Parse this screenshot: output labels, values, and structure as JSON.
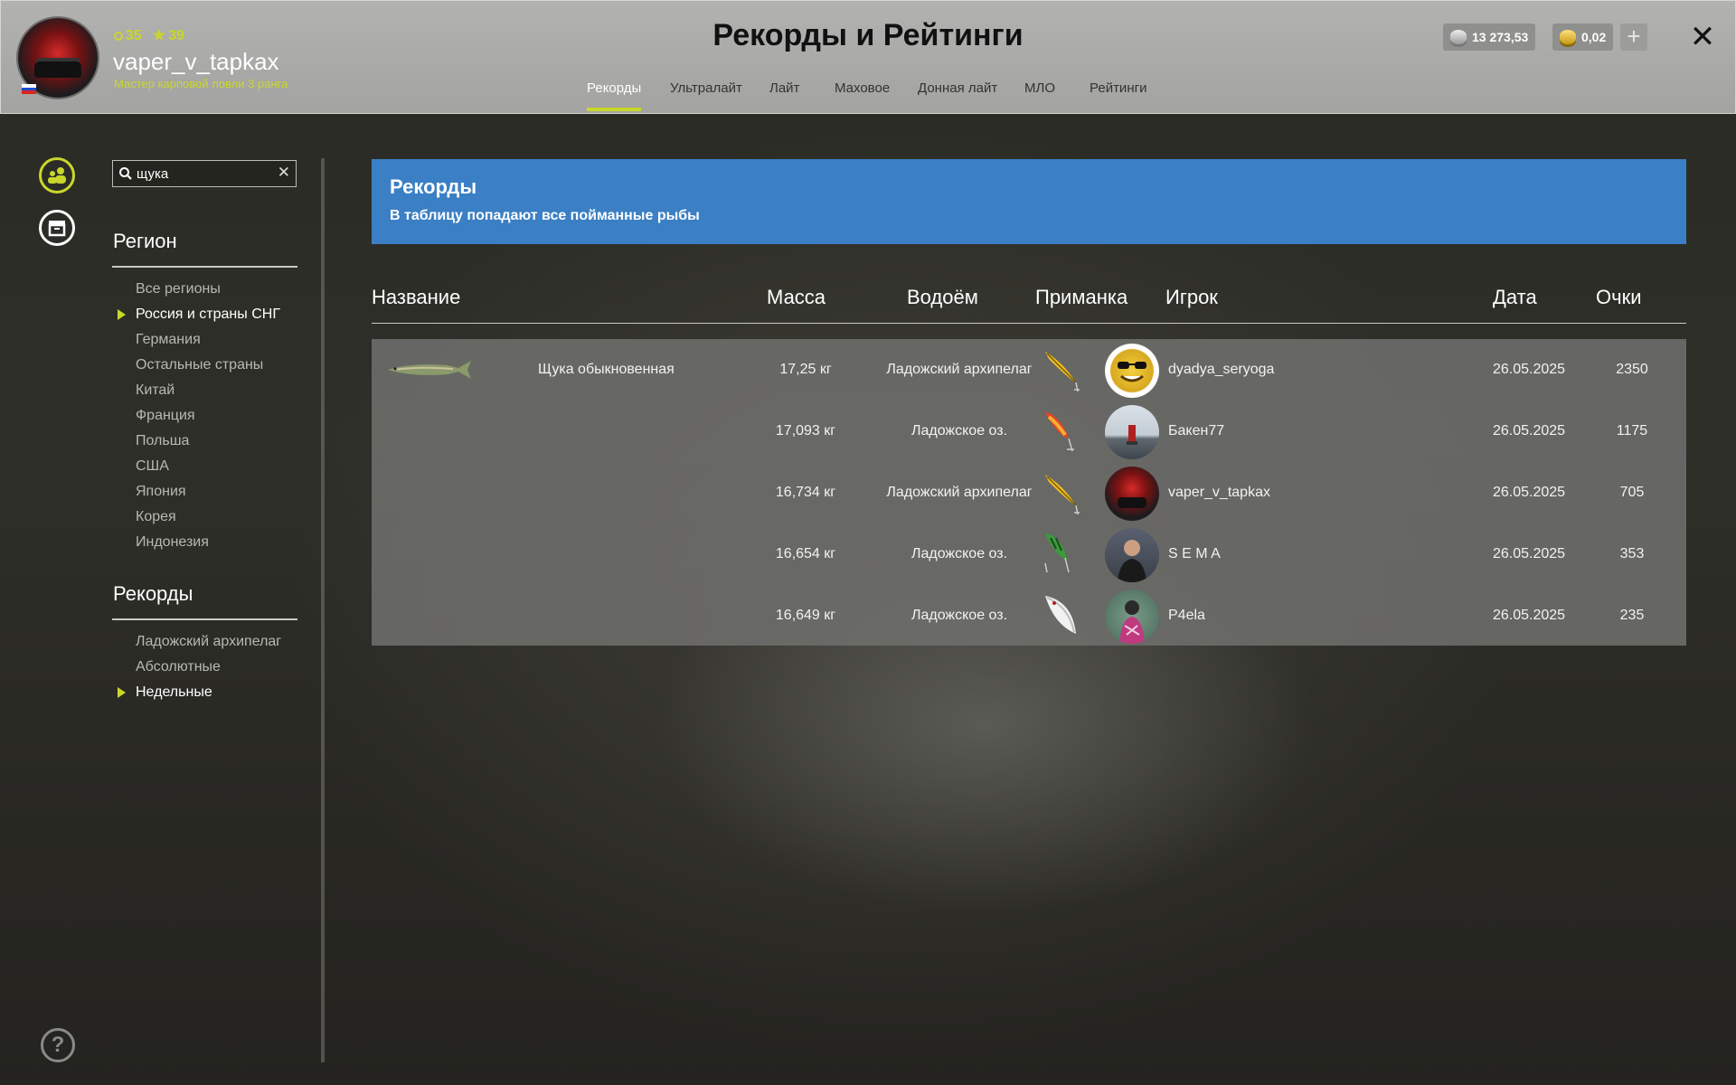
{
  "window": {
    "title": "Рекорды и Рейтинги",
    "close_label": "✕"
  },
  "profile": {
    "level": "35",
    "stars": "39",
    "username": "vaper_v_tapkax",
    "rank": "Мастер карповой ловли 3 ранга"
  },
  "tabs": [
    {
      "label": "Рекорды",
      "active": true
    },
    {
      "label": "Ультралайт",
      "active": false
    },
    {
      "label": "Лайт",
      "active": false
    },
    {
      "label": "Маховое",
      "active": false
    },
    {
      "label": "Донная лайт",
      "active": false
    },
    {
      "label": "МЛО",
      "active": false
    },
    {
      "label": "Рейтинги",
      "active": false
    }
  ],
  "currency": {
    "silver": "13 273,53",
    "gold": "0,02",
    "add_label": "+"
  },
  "sidebar": {
    "search": {
      "value": "щука",
      "clear_label": "✕"
    },
    "region_title": "Регион",
    "regions": [
      {
        "label": "Все регионы",
        "selected": false
      },
      {
        "label": "Россия и страны СНГ",
        "selected": true
      },
      {
        "label": "Германия",
        "selected": false
      },
      {
        "label": "Остальные страны",
        "selected": false
      },
      {
        "label": "Китай",
        "selected": false
      },
      {
        "label": "Франция",
        "selected": false
      },
      {
        "label": "Польша",
        "selected": false
      },
      {
        "label": "США",
        "selected": false
      },
      {
        "label": "Япония",
        "selected": false
      },
      {
        "label": "Корея",
        "selected": false
      },
      {
        "label": "Индонезия",
        "selected": false
      }
    ],
    "records_title": "Рекорды",
    "records": [
      {
        "label": "Ладожский архипелаг",
        "selected": false
      },
      {
        "label": "Абсолютные",
        "selected": false
      },
      {
        "label": "Недельные",
        "selected": true
      }
    ],
    "help_label": "?"
  },
  "banner": {
    "title": "Рекорды",
    "subtitle": "В таблицу попадают все пойманные рыбы"
  },
  "table": {
    "columns": [
      "Название",
      "Масса",
      "Водоём",
      "Приманка",
      "Игрок",
      "Дата",
      "Очки"
    ],
    "fish_name": "Щука обыкновенная",
    "rows": [
      {
        "mass": "17,25 кг",
        "water": "Ладожский архипелаг",
        "lure": "yellow-minnow-lure",
        "player": "dyadya_seryoga",
        "avatar": "smiley-sunglasses-avatar",
        "date": "26.05.2025",
        "points": "2350"
      },
      {
        "mass": "17,093 кг",
        "water": "Ладожское оз.",
        "lure": "red-orange-wobbler-lure",
        "player": "Бакен77",
        "avatar": "buoy-lake-avatar",
        "date": "26.05.2025",
        "points": "1175"
      },
      {
        "mass": "16,734 кг",
        "water": "Ладожский архипелаг",
        "lure": "yellow-minnow-lure",
        "player": "vaper_v_tapkax",
        "avatar": "red-car-avatar",
        "date": "26.05.2025",
        "points": "705"
      },
      {
        "mass": "16,654 кг",
        "water": "Ладожское оз.",
        "lure": "green-perch-wobbler-lure",
        "player": "S E M A",
        "avatar": "man-photo-avatar",
        "date": "26.05.2025",
        "points": "353"
      },
      {
        "mass": "16,649 кг",
        "water": "Ладожское оз.",
        "lure": "white-spoon-lure",
        "player": "P4ela",
        "avatar": "person-pink-avatar",
        "date": "26.05.2025",
        "points": "235"
      }
    ]
  },
  "colors": {
    "accent": "#c9d72b",
    "banner": "#3b7fc4",
    "header": "#a8a8a6"
  }
}
